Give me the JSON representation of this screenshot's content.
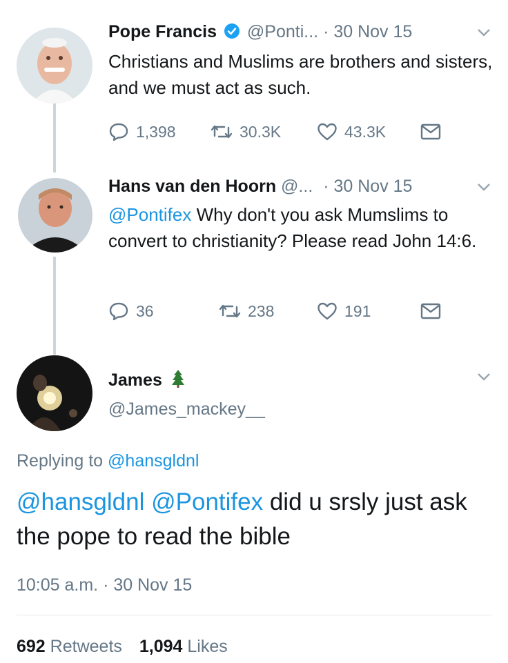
{
  "tweet1": {
    "name": "Pope Francis",
    "handle": "@Ponti...",
    "date": "· 30 Nov 15",
    "text": "Christians and Muslims are brothers and sisters, and we must act as such.",
    "replies": "1,398",
    "retweets": "30.3K",
    "likes": "43.3K"
  },
  "tweet2": {
    "name": "Hans van den Hoorn",
    "handle": "@...",
    "date": "· 30 Nov 15",
    "mention": "@Pontifex",
    "text": " Why don't you ask Mumslims to convert to christianity? Please read John 14:6.",
    "replies": "36",
    "retweets": "238",
    "likes": "191"
  },
  "tweet3": {
    "name": "James",
    "handle": "@James_mackey__",
    "replying_prefix": "Replying to ",
    "replying_handle": "@hansgldnl",
    "mention1": "@hansgldnl",
    "mention2": "@Pontifex",
    "text": " did u srsly just ask the pope to read the bible",
    "timestamp": "10:05 a.m. · 30 Nov 15"
  },
  "stats": {
    "retweets_count": "692",
    "retweets_label": "Retweets",
    "likes_count": "1,094",
    "likes_label": "Likes"
  },
  "colors": {
    "link": "#1b95e0",
    "muted": "#657786",
    "verified": "#1da1f2",
    "tree": "#2e7d32"
  }
}
